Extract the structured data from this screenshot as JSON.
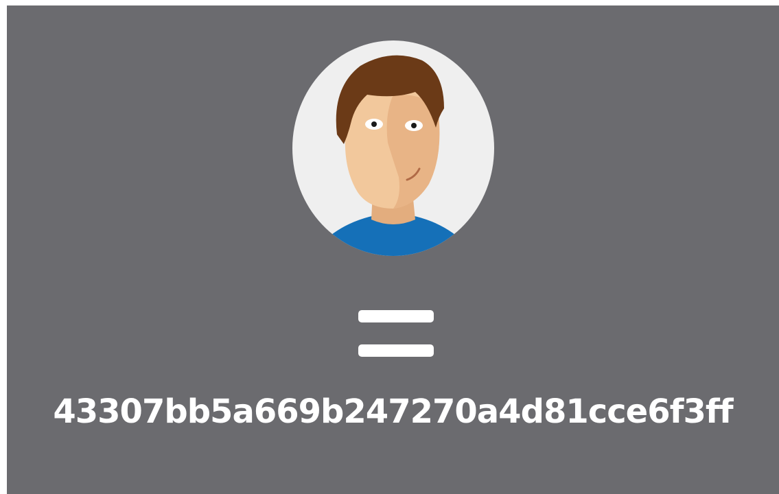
{
  "avatar": {
    "icon": "user-avatar-icon",
    "colors": {
      "circle_bg": "#efefef",
      "skin_light": "#f2c89c",
      "skin_dark": "#e3ad7e",
      "hair": "#6b3a17",
      "shirt": "#1570b8"
    }
  },
  "operator": {
    "icon": "equals-icon",
    "color": "#ffffff"
  },
  "hash_text": "43307bb5a669b247270a4d81cce6f3ff",
  "colors": {
    "panel_bg": "#6b6b6f",
    "text": "#ffffff"
  }
}
